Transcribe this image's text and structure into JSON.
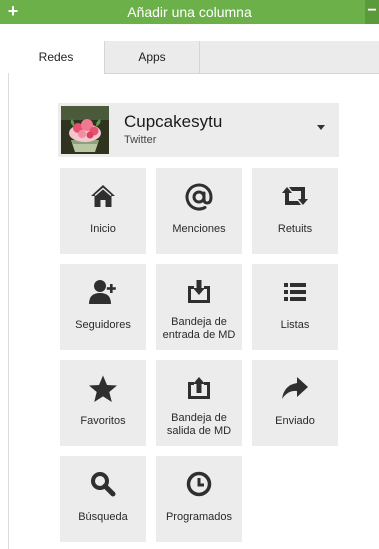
{
  "header": {
    "title": "Añadir una columna",
    "add_symbol": "+",
    "minimize_symbol": "−"
  },
  "tabs": [
    {
      "label": "Redes"
    },
    {
      "label": "Apps"
    }
  ],
  "account": {
    "name": "Cupcakesytu",
    "network": "Twitter"
  },
  "tiles": [
    {
      "label": "Inicio",
      "icon": "home-icon"
    },
    {
      "label": "Menciones",
      "icon": "at-icon"
    },
    {
      "label": "Retuits",
      "icon": "retweet-icon"
    },
    {
      "label": "Seguidores",
      "icon": "add-user-icon"
    },
    {
      "label": "Bandeja de entrada de MD",
      "icon": "inbox-download-icon"
    },
    {
      "label": "Listas",
      "icon": "list-icon"
    },
    {
      "label": "Favoritos",
      "icon": "star-icon"
    },
    {
      "label": "Bandeja de salida de MD",
      "icon": "outbox-upload-icon"
    },
    {
      "label": "Enviado",
      "icon": "share-arrow-icon"
    },
    {
      "label": "Búsqueda",
      "icon": "search-icon"
    },
    {
      "label": "Programados",
      "icon": "clock-icon"
    }
  ],
  "colors": {
    "header": "#6cb04a",
    "tile_bg": "#ececec",
    "icon": "#2f2f2f"
  }
}
